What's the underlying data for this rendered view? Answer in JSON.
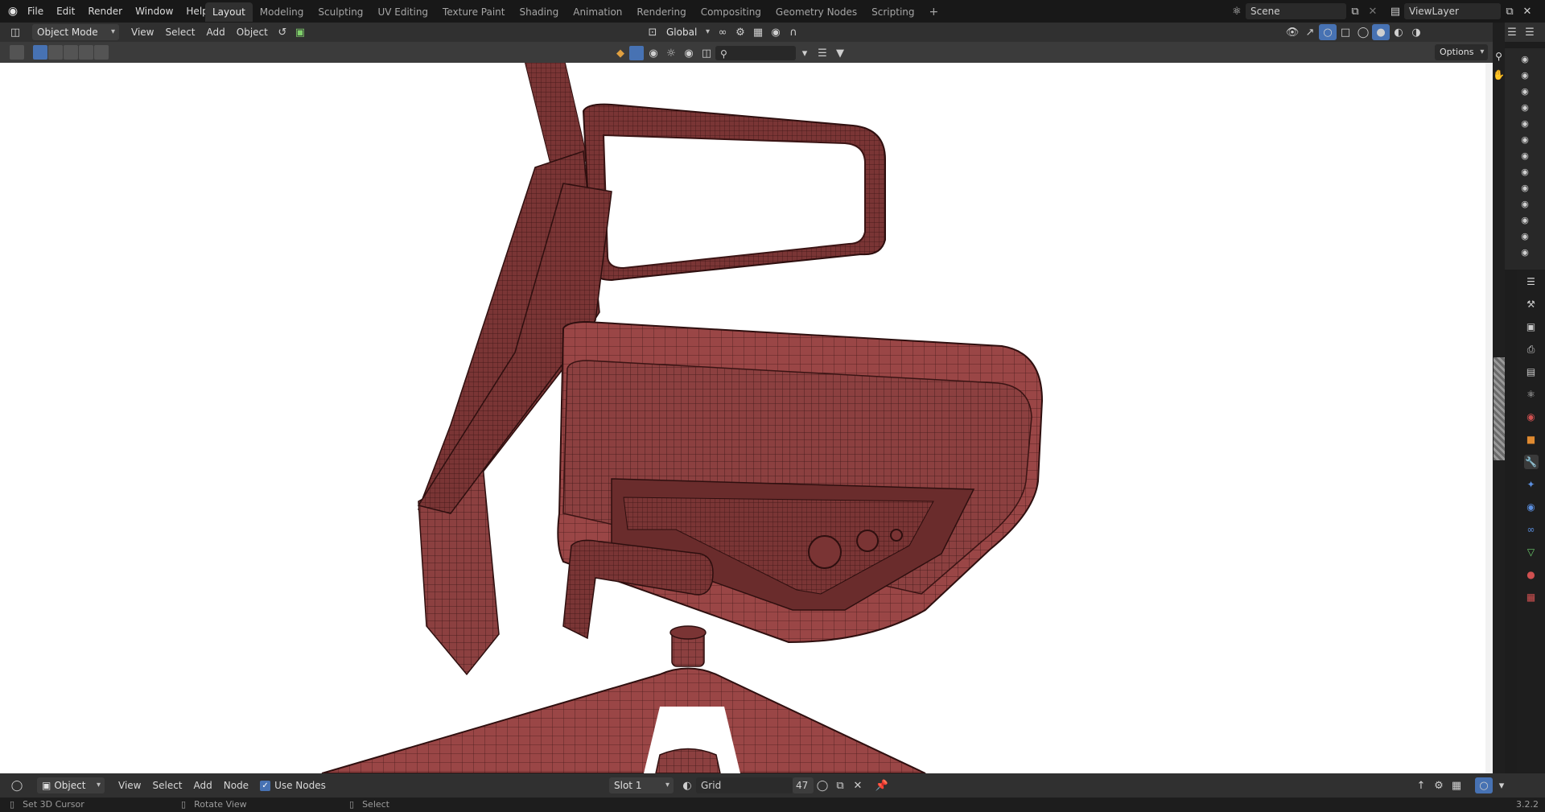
{
  "menus": [
    "File",
    "Edit",
    "Render",
    "Window",
    "Help"
  ],
  "workspaces": [
    "Layout",
    "Modeling",
    "Sculpting",
    "UV Editing",
    "Texture Paint",
    "Shading",
    "Animation",
    "Rendering",
    "Compositing",
    "Geometry Nodes",
    "Scripting"
  ],
  "active_workspace": "Layout",
  "scene": {
    "name": "Scene"
  },
  "view_layer": {
    "name": "ViewLayer"
  },
  "header": {
    "mode": "Object Mode",
    "menus": [
      "View",
      "Select",
      "Add",
      "Object"
    ],
    "orientation": "Global",
    "options_label": "Options"
  },
  "bottom": {
    "editor_mode": "Object",
    "menus": [
      "View",
      "Select",
      "Add",
      "Node"
    ],
    "use_nodes_label": "Use Nodes",
    "slot": "Slot 1",
    "material": "Grid",
    "users": "47"
  },
  "status": {
    "hint1": "Set 3D Cursor",
    "hint2": "Rotate View",
    "hint3": "Select",
    "version": "3.2.2"
  },
  "colors": {
    "accent": "#4772b3",
    "mesh": "#8a3f3f",
    "wire": "#3a1616"
  }
}
